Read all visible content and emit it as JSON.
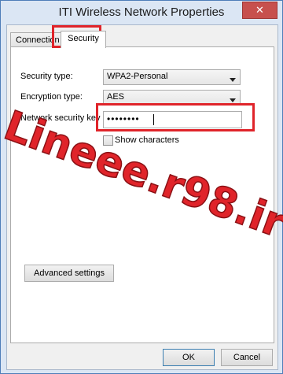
{
  "window": {
    "title": "ITI Wireless Network Properties",
    "close_glyph": "✕"
  },
  "tabs": [
    {
      "label": "Connection",
      "active": false
    },
    {
      "label": "Security",
      "active": true
    }
  ],
  "form": {
    "security_type_label": "Security type:",
    "security_type_value": "WPA2-Personal",
    "encryption_type_label": "Encryption type:",
    "encryption_type_value": "AES",
    "key_label": "Network security key",
    "key_value": "••••••••",
    "show_characters_label": "Show characters",
    "show_characters_checked": false
  },
  "buttons": {
    "advanced": "Advanced settings",
    "ok": "OK",
    "cancel": "Cancel"
  },
  "watermark": {
    "text": "Lineee.r98.ir",
    "color": "#e0242a"
  },
  "highlight_color": "#e0242a"
}
